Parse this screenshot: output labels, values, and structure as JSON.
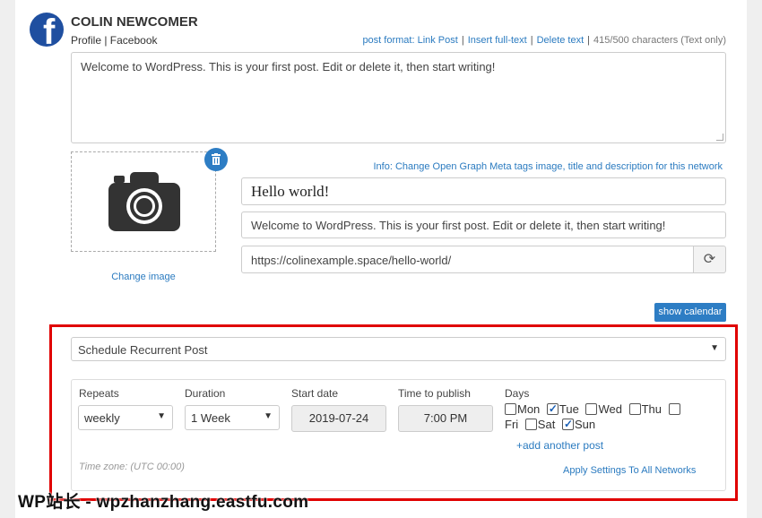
{
  "account": {
    "name": "COLIN NEWCOMER",
    "subtitle": "Profile | Facebook",
    "icon": "facebook-icon"
  },
  "links": {
    "post_format": "post format: Link Post",
    "insert_full_text": "Insert full-text",
    "delete_text": "Delete text",
    "char_count": "415/500 characters (Text only)"
  },
  "post_text": "Welcome to WordPress. This is your first post. Edit or delete it, then start writing!",
  "image": {
    "change_label": "Change image"
  },
  "og": {
    "info": "Info: Change Open Graph Meta tags image, title and description for this network",
    "title": "Hello world!",
    "description": "Welcome to WordPress. This is your first post. Edit or delete it, then start writing!",
    "url": "https://colinexample.space/hello-world/"
  },
  "show_calendar": "show calendar",
  "schedule": {
    "type": "Schedule Recurrent Post",
    "repeats_label": "Repeats",
    "repeats_value": "weekly",
    "duration_label": "Duration",
    "duration_value": "1 Week",
    "start_label": "Start date",
    "start_value": "2019-07-24",
    "time_label": "Time to publish",
    "time_value": "7:00 PM",
    "days_label": "Days",
    "days": [
      {
        "label": "Mon",
        "checked": false
      },
      {
        "label": "Tue",
        "checked": true
      },
      {
        "label": "Wed",
        "checked": false
      },
      {
        "label": "Thu",
        "checked": false
      },
      {
        "label": "Fri",
        "checked": false
      },
      {
        "label": "Sat",
        "checked": false
      },
      {
        "label": "Sun",
        "checked": true
      }
    ],
    "add_another": "+add another post",
    "timezone": "Time zone: (UTC 00:00)",
    "apply_all": "Apply Settings To All Networks"
  },
  "watermark": "WP站长 - wpzhanzhang.eastfu.com",
  "colors": {
    "accent": "#2d7dc4",
    "highlight": "#e00000",
    "facebook": "#1f4fa0"
  }
}
